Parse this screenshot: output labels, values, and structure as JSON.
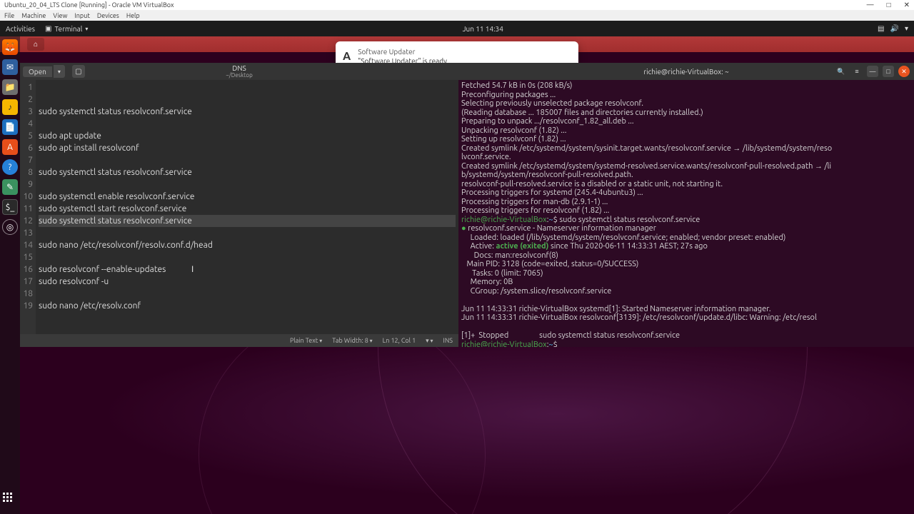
{
  "vbox": {
    "title": "Ubuntu_20_04_LTS Clone [Running] - Oracle VM VirtualBox",
    "menu": [
      "File",
      "Machine",
      "View",
      "Input",
      "Devices",
      "Help"
    ]
  },
  "gnome": {
    "activities": "Activities",
    "app": "Terminal",
    "clock": "Jun 11  14:34"
  },
  "notification": {
    "title": "Software Updater",
    "body": "\"Software Updater\" is ready"
  },
  "gedit": {
    "open": "Open",
    "filename": "DNS",
    "path": "~/Desktop",
    "lines": [
      "",
      "",
      "sudo systemctl status resolvconf.service",
      "",
      "sudo apt update",
      "sudo apt install resolvconf",
      "",
      "sudo systemctl status resolvconf.service",
      "",
      "sudo systemctl enable resolvconf.service",
      "sudo systemctl start resolvconf.service",
      "sudo systemctl status resolvconf.service",
      "",
      "sudo nano /etc/resolvconf/resolv.conf.d/head",
      "",
      "sudo resolvconf --enable-updates",
      "sudo resolvconf -u",
      "",
      "sudo nano /etc/resolv.conf"
    ],
    "highlighted_line": 12,
    "status": {
      "plain": "Plain Text",
      "tab": "Tab Width: 8",
      "pos": "Ln 12, Col 1",
      "ins": "INS"
    }
  },
  "terminal": {
    "title": "richie@richie-VirtualBox: ~",
    "prompt_user": "richie@richie-VirtualBox",
    "prompt_path": "~",
    "output": [
      "Fetched 54.7 kB in 0s (208 kB/s)",
      "Preconfiguring packages ...",
      "Selecting previously unselected package resolvconf.",
      "(Reading database ... 185007 files and directories currently installed.)",
      "Preparing to unpack .../resolvconf_1.82_all.deb ...",
      "Unpacking resolvconf (1.82) ...",
      "Setting up resolvconf (1.82) ...",
      "Created symlink /etc/systemd/system/sysinit.target.wants/resolvconf.service → /lib/systemd/system/reso",
      "lvconf.service.",
      "Created symlink /etc/systemd/system/systemd-resolved.service.wants/resolvconf-pull-resolved.path → /li",
      "b/systemd/system/resolvconf-pull-resolved.path.",
      "resolvconf-pull-resolved.service is a disabled or a static unit, not starting it.",
      "Processing triggers for systemd (245.4-4ubuntu3) ...",
      "Processing triggers for man-db (2.9.1-1) ...",
      "Processing triggers for resolvconf (1.82) ..."
    ],
    "cmd1": "sudo systemctl status resolvconf.service",
    "service_line": "resolvconf.service - Nameserver information manager",
    "loaded": "     Loaded: loaded (/lib/systemd/system/resolvconf.service; enabled; vendor preset: enabled)",
    "active_prefix": "     Active: ",
    "active_status": "active (exited)",
    "active_suffix": " since Thu 2020-06-11 14:33:31 AEST; 27s ago",
    "docs": "       Docs: man:resolvconf(8)",
    "pid": "   Main PID: 3128 (code=exited, status=0/SUCCESS)",
    "tasks": "      Tasks: 0 (limit: 7065)",
    "memory": "     Memory: 0B",
    "cgroup": "     CGroup: /system.slice/resolvconf.service",
    "log1": "Jun 11 14:33:31 richie-VirtualBox systemd[1]: Started Nameserver information manager.",
    "log2": "Jun 11 14:33:31 richie-VirtualBox resolvconf[3139]: /etc/resolvconf/update.d/libc: Warning: /etc/resol",
    "stopped": "[1]+  Stopped                 sudo systemctl status resolvconf.service"
  }
}
